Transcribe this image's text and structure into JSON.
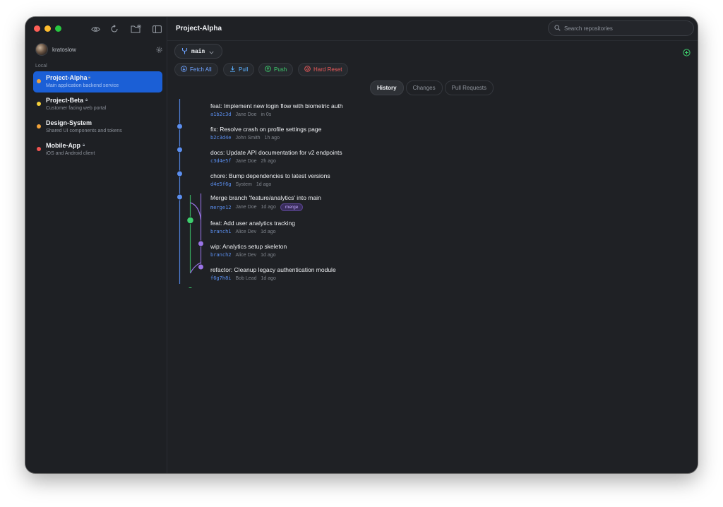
{
  "window": {
    "title": "Project-Alpha"
  },
  "titlebar": {
    "icons": [
      "eye-icon",
      "refresh-icon",
      "folder-add-icon",
      "sidebar-toggle-icon"
    ]
  },
  "user": {
    "name": "kratoslow"
  },
  "sidebar": {
    "section_label": "Local",
    "repos": [
      {
        "name": "Project-Alpha",
        "desc": "Main application backend service",
        "locked": true,
        "dot": "#f2a33a"
      },
      {
        "name": "Project-Beta",
        "desc": "Customer facing web portal",
        "locked": true,
        "dot": "#f5d03b"
      },
      {
        "name": "Design-System",
        "desc": "Shared UI components and tokens",
        "locked": false,
        "dot": "#f2a33a"
      },
      {
        "name": "Mobile-App",
        "desc": "iOS and Android client",
        "locked": true,
        "dot": "#ef5350"
      }
    ]
  },
  "search": {
    "placeholder": "Search repositories"
  },
  "branch": {
    "name": "main"
  },
  "actions": {
    "fetch": "Fetch All",
    "pull": "Pull",
    "push": "Push",
    "reset": "Hard Reset"
  },
  "tabs": {
    "history": "History",
    "changes": "Changes",
    "pulls": "Pull Requests"
  },
  "commits": [
    {
      "message": "feat: Implement new login flow with biometric auth",
      "hash": "a1b2c3d",
      "author": "Jane Doe",
      "time": "in 0s"
    },
    {
      "message": "fix: Resolve crash on profile settings page",
      "hash": "b2c3d4e",
      "author": "John Smith",
      "time": "1h ago"
    },
    {
      "message": "docs: Update API documentation for v2 endpoints",
      "hash": "c3d4e5f",
      "author": "Jane Doe",
      "time": "2h ago"
    },
    {
      "message": "chore: Bump dependencies to latest versions",
      "hash": "d4e5f6g",
      "author": "System",
      "time": "1d ago"
    },
    {
      "message": "Merge branch 'feature/analytics' into main",
      "hash": "merge12",
      "author": "Jane Doe",
      "time": "1d ago",
      "badge": "merge"
    },
    {
      "message": "feat: Add user analytics tracking",
      "hash": "branch1",
      "author": "Alice Dev",
      "time": "1d ago"
    },
    {
      "message": "wip: Analytics setup skeleton",
      "hash": "branch2",
      "author": "Alice Dev",
      "time": "1d ago"
    },
    {
      "message": "refactor: Cleanup legacy authentication module",
      "hash": "f6g7h8i",
      "author": "Bob Lead",
      "time": "1d ago"
    }
  ],
  "colors": {
    "accent": "#1b5fd6",
    "graph_blue": "#5b8ff0",
    "graph_green": "#3ecf6e",
    "graph_purple": "#9b74e8",
    "fetch": "#6ea2ff",
    "pull": "#5ab0ff",
    "push": "#3ecf6e",
    "reset": "#ef5b5b"
  }
}
